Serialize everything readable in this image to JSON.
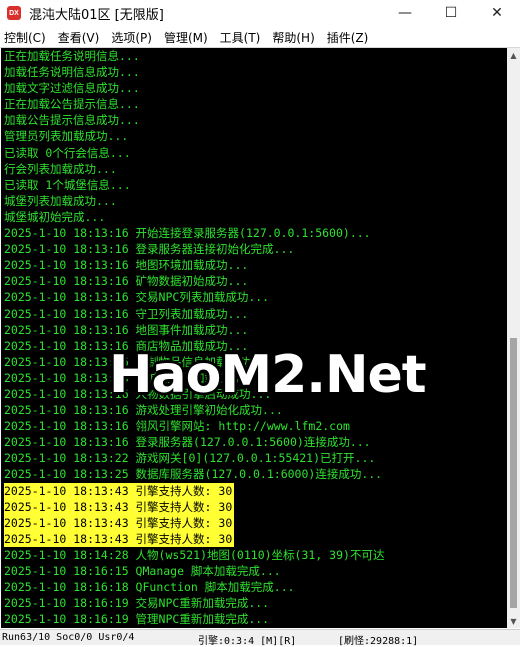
{
  "window": {
    "title": "混沌大陆01区 [无限版]",
    "icon_text": "DX",
    "minimize_glyph": "—",
    "maximize_glyph": "☐",
    "close_glyph": "✕"
  },
  "menu": [
    "控制(C)",
    "查看(V)",
    "选项(P)",
    "管理(M)",
    "工具(T)",
    "帮助(H)",
    "插件(Z)"
  ],
  "console": {
    "lines": [
      "正在加载任务说明信息...",
      "加载任务说明信息成功...",
      "加载文字过滤信息成功...",
      "正在加载公告提示信息...",
      "加载公告提示信息成功...",
      "管理员列表加载成功...",
      "已读取 0个行会信息...",
      "行会列表加载成功...",
      "已读取 1个城堡信息...",
      "城堡列表加载成功...",
      "城堡城初始完成...",
      "2025-1-10 18:13:16 开始连接登录服务器(127.0.0.1:5600)...",
      "2025-1-10 18:13:16 登录服务器连接初始化完成...",
      "2025-1-10 18:13:16 地图环境加载成功...",
      "2025-1-10 18:13:16 矿物数据初始成功...",
      "2025-1-10 18:13:16 交易NPC列表加载成功...",
      "2025-1-10 18:13:16 守卫列表加载成功...",
      "2025-1-10 18:13:16 地图事件加载成功...",
      "2025-1-10 18:13:16 商店物品加载成功...",
      "2025-1-10 18:13:16 炼制物品信息加载成功...",
      "2025-1-10 18:13:16 回城点配置加载成功...",
      "2025-1-10 18:13:16 人物数据引擎启动成功...",
      "2025-1-10 18:13:16 游戏处理引擎初始化成功...",
      "2025-1-10 18:13:16 翎风引擎网站: http://www.lfm2.com",
      "2025-1-10 18:13:16 登录服务器(127.0.0.1:5600)连接成功...",
      "2025-1-10 18:13:22 游戏网关[0](127.0.0.1:55421)已打开...",
      "2025-1-10 18:13:25 数据库服务器(127.0.0.1:6000)连接成功...",
      "2025-1-10 18:13:43 引擎支持人数: 30",
      "2025-1-10 18:13:43 引擎支持人数: 30",
      "2025-1-10 18:13:43 引擎支持人数: 30",
      "2025-1-10 18:13:43 引擎支持人数: 30",
      "2025-1-10 18:14:28 人物(ws521)地图(0110)坐标(31, 39)不可达",
      "2025-1-10 18:16:15 QManage 脚本加载完成...",
      "2025-1-10 18:16:18 QFunction 脚本加载完成...",
      "2025-1-10 18:16:19 交易NPC重新加载完成...",
      "2025-1-10 18:16:19 管理NPC重新加载完成..."
    ],
    "highlighted_indices": [
      27,
      28,
      29,
      30
    ],
    "text_color": "#2fe22f",
    "highlight_color": "#ffff33",
    "background": "#000000"
  },
  "watermark": {
    "text": "HaoM2.Net"
  },
  "scrollbar": {
    "up_glyph": "▲",
    "down_glyph": "▼"
  },
  "statusbar": {
    "left": "Run63/10 Soc0/0 Usr0/4",
    "middle": "引擎:0:3:4 [M][R]",
    "right": "[刷怪:29288:1]"
  }
}
